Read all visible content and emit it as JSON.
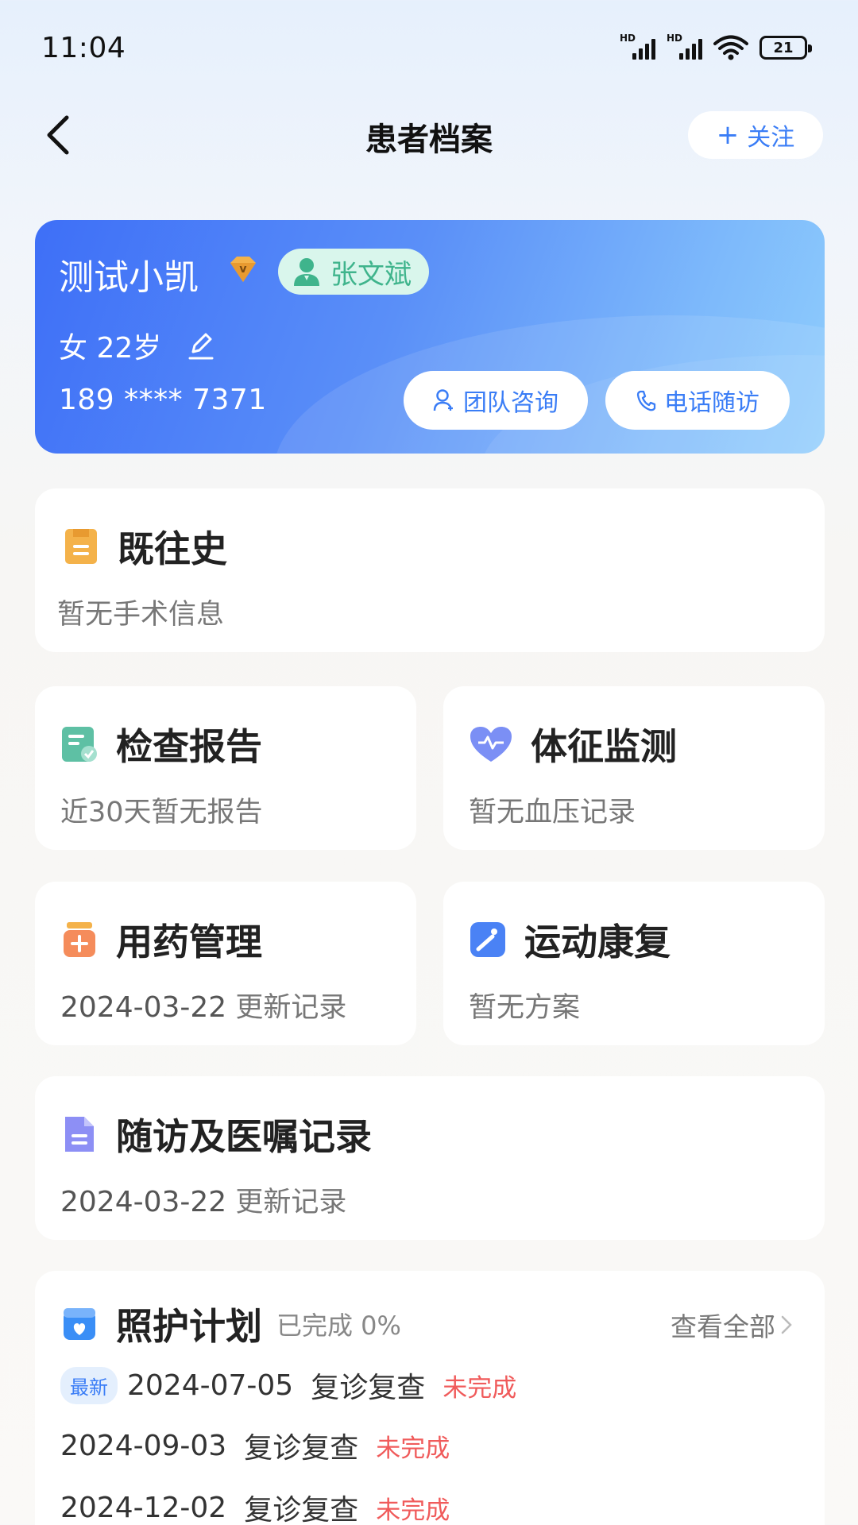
{
  "status_bar": {
    "time": "11:04",
    "signal1_label": "HD",
    "signal2_label": "HD",
    "battery": "21"
  },
  "header": {
    "title": "患者档案",
    "follow_icon": "+",
    "follow_label": "关注"
  },
  "profile": {
    "name": "测试小凯",
    "doctor": "张文斌",
    "gender_age": "女 22岁",
    "phone": "189 **** 7371",
    "team_consult": "团队咨询",
    "phone_followup": "电话随访",
    "colors": {
      "card_start": "#3e6ff7",
      "card_end": "#8fcdfc",
      "doctor_tag_bg": "#d9f6ec",
      "doctor_tag_text": "#3fb48c"
    }
  },
  "history": {
    "title": "既往史",
    "subtitle": "暂无手术信息"
  },
  "exam": {
    "title": "检查报告",
    "subtitle": "近30天暂无报告"
  },
  "vitals": {
    "title": "体征监测",
    "subtitle": "暂无血压记录"
  },
  "medication": {
    "title": "用药管理",
    "date": "2024-03-22",
    "suffix": "更新记录"
  },
  "sport": {
    "title": "运动康复",
    "subtitle": "暂无方案"
  },
  "followup": {
    "title": "随访及医嘱记录",
    "date": "2024-03-22",
    "suffix": "更新记录"
  },
  "care_plan": {
    "title": "照护计划",
    "progress": "已完成 0%",
    "view_all": "查看全部",
    "new_badge": "最新",
    "items": [
      {
        "date": "2024-07-05",
        "type": "复诊复查",
        "status": "未完成"
      },
      {
        "date": "2024-09-03",
        "type": "复诊复查",
        "status": "未完成"
      },
      {
        "date": "2024-12-02",
        "type": "复诊复查",
        "status": "未完成"
      }
    ]
  }
}
